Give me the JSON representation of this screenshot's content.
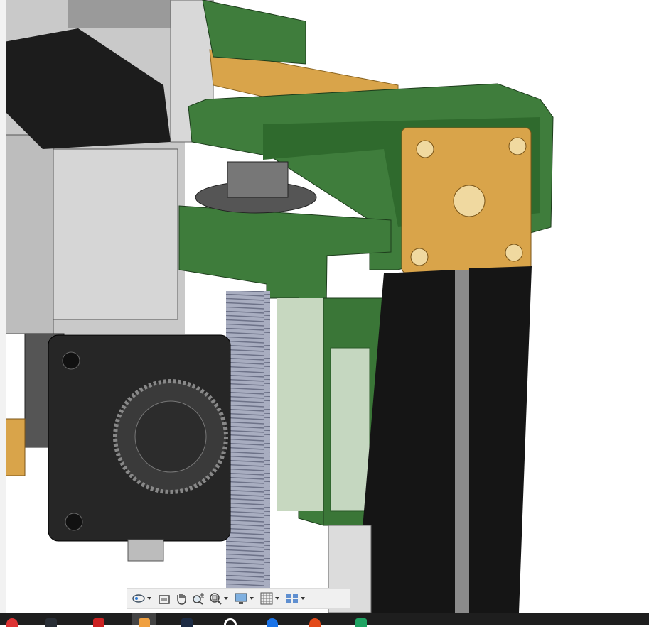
{
  "app": {
    "viewport": "3d-model-viewport"
  },
  "colors": {
    "bracket_green": "#3f7d3c",
    "extrusion_gold": "#d9a44a",
    "rail_black": "#151515",
    "body_gray": "#c8c8c8",
    "leadscrew": "#a8adc0",
    "taskbar": "#1e1e1e",
    "toolbar": "#f0f0f0"
  },
  "toolbar": {
    "items": [
      {
        "icon": "orbit-icon",
        "has_dropdown": true
      },
      {
        "icon": "look-at-icon",
        "has_dropdown": false
      },
      {
        "icon": "pan-hand-icon",
        "has_dropdown": false
      },
      {
        "icon": "zoom-icon",
        "has_dropdown": false
      },
      {
        "icon": "fit-zoom-window-icon",
        "has_dropdown": true
      },
      {
        "icon": "display-settings-icon",
        "has_dropdown": true
      },
      {
        "icon": "grid-settings-icon",
        "has_dropdown": true
      },
      {
        "icon": "viewports-icon",
        "has_dropdown": true
      }
    ]
  },
  "taskbar": {
    "apps": [
      {
        "icon": "red-app-icon",
        "color": "#d33"
      },
      {
        "icon": "dark-app-icon",
        "color": "#2a2f36"
      },
      {
        "icon": "red-diamond-app-icon",
        "color": "#c22"
      },
      {
        "icon": "fusion-app-icon",
        "color": "#f0a040",
        "active": true
      },
      {
        "icon": "blue-app-icon",
        "color": "#1d2c44"
      },
      {
        "icon": "chrome-icon",
        "color": "#ffffff"
      },
      {
        "icon": "blue-circle-app-icon",
        "color": "#1a73e8"
      },
      {
        "icon": "orange-app-icon",
        "color": "#e34a1a"
      },
      {
        "icon": "green-app-icon",
        "color": "#1fa463"
      }
    ]
  }
}
